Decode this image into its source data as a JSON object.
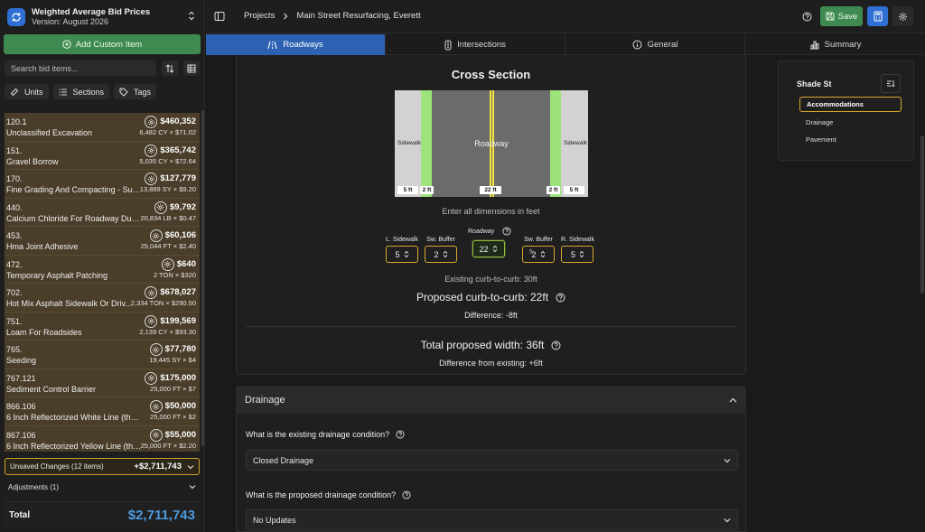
{
  "app": {
    "title": "Weighted Average Bid Prices",
    "version": "Version: August 2026"
  },
  "sidebar": {
    "add_label": "Add Custom Item",
    "search_placeholder": "Search bid items...",
    "chips": [
      "Units",
      "Sections",
      "Tags"
    ],
    "items": [
      {
        "num": "120.1",
        "name": "Unclassified Excavation",
        "amount": "$460,352",
        "qty": "6,482 CY × $71.02"
      },
      {
        "num": "151.",
        "name": "Gravel Borrow",
        "amount": "$365,742",
        "qty": "5,035 CY × $72.64"
      },
      {
        "num": "170.",
        "name": "Fine Grading And Compacting - Sub...",
        "amount": "$127,779",
        "qty": "13,889 SY × $9.20"
      },
      {
        "num": "440.",
        "name": "Calcium Chloride For Roadway Dust ...",
        "amount": "$9,792",
        "qty": "20,834 LB × $0.47"
      },
      {
        "num": "453.",
        "name": "Hma Joint Adhesive",
        "amount": "$60,106",
        "qty": "25,044 FT × $2.40"
      },
      {
        "num": "472.",
        "name": "Temporary Asphalt Patching",
        "amount": "$640",
        "qty": "2 TON × $320"
      },
      {
        "num": "702.",
        "name": "Hot Mix Asphalt Sidewalk Or Driv...",
        "amount": "$678,027",
        "qty": "2,334 TON × $290.50"
      },
      {
        "num": "751.",
        "name": "Loam For Roadsides",
        "amount": "$199,569",
        "qty": "2,139 CY × $93.30"
      },
      {
        "num": "765.",
        "name": "Seeding",
        "amount": "$77,780",
        "qty": "19,445 SY × $4"
      },
      {
        "num": "767.121",
        "name": "Sediment Control Barrier",
        "amount": "$175,000",
        "qty": "25,000 FT × $7"
      },
      {
        "num": "866.106",
        "name": "6 Inch Reflectorized White Line (thermo...",
        "amount": "$50,000",
        "qty": "25,000 FT × $2"
      },
      {
        "num": "867.106",
        "name": "6 Inch Reflectorized Yellow Line (ther...",
        "amount": "$55,000",
        "qty": "25,000 FT × $2.20"
      }
    ],
    "unsaved_label": "Unsaved Changes (12 items)",
    "unsaved_amount": "+$2,711,743",
    "adjustments_label": "Adjustments (1)",
    "total_label": "Total",
    "total_amount": "$2,711,743"
  },
  "topbar": {
    "crumb_root": "Projects",
    "crumb_current": "Main Street Resurfacing, Everett",
    "save_label": "Save"
  },
  "tabs": [
    {
      "label": "Roadways",
      "icon": "road-icon",
      "active": true
    },
    {
      "label": "Intersections",
      "icon": "traffic-light-icon",
      "active": false
    },
    {
      "label": "General",
      "icon": "info-icon",
      "active": false
    },
    {
      "label": "Summary",
      "icon": "bar-chart-icon",
      "active": false
    }
  ],
  "cross_section": {
    "title": "Cross Section",
    "sidewalk_label": "Sidewalk",
    "roadway_label": "Roadway",
    "dims": [
      "5 ft",
      "2 ft",
      "22 ft",
      "2 ft",
      "5 ft"
    ],
    "hint": "Enter all dimensions in feet",
    "fields": [
      {
        "label": "L. Sidewalk",
        "value": "5"
      },
      {
        "label": "Sw. Buffer",
        "value": "2"
      },
      {
        "label": "Roadway",
        "value": "22"
      },
      {
        "label": "Sw. Buffer",
        "value": "2"
      },
      {
        "label": "R. Sidewalk",
        "value": "5"
      }
    ],
    "ft_label": "ft",
    "existing": "Existing curb-to-curb: 30ft",
    "proposed": "Proposed curb-to-curb: 22ft",
    "difference": "Difference: -8ft",
    "total": "Total proposed width: 36ft",
    "total_diff": "Difference from existing: +6ft"
  },
  "drainage": {
    "title": "Drainage",
    "q1": "What is the existing drainage condition?",
    "a1": "Closed Drainage",
    "q2": "What is the proposed drainage condition?",
    "a2": "No Updates"
  },
  "right_panel": {
    "title": "Shade St",
    "items": [
      "Accommodations",
      "Drainage",
      "Pavement"
    ],
    "active": "Accommodations"
  },
  "colors": {
    "accent_blue": "#2d62b3",
    "save_green": "#3f8a50",
    "highlight_gold": "#d9a92c",
    "total_blue": "#4d9be0"
  }
}
